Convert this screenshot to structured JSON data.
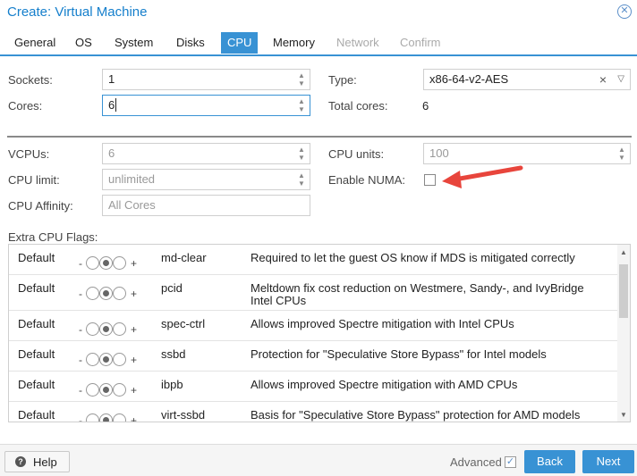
{
  "window": {
    "title": "Create: Virtual Machine"
  },
  "tabs": [
    {
      "label": "General"
    },
    {
      "label": "OS"
    },
    {
      "label": "System"
    },
    {
      "label": "Disks"
    },
    {
      "label": "CPU"
    },
    {
      "label": "Memory"
    },
    {
      "label": "Network"
    },
    {
      "label": "Confirm"
    }
  ],
  "active_tab": "CPU",
  "form": {
    "sockets_label": "Sockets:",
    "sockets_value": "1",
    "cores_label": "Cores:",
    "cores_value": "6",
    "type_label": "Type:",
    "type_value": "x86-64-v2-AES",
    "total_cores_label": "Total cores:",
    "total_cores_value": "6",
    "vcpus_label": "VCPUs:",
    "vcpus_value": "6",
    "cpu_units_label": "CPU units:",
    "cpu_units_value": "100",
    "cpu_limit_label": "CPU limit:",
    "cpu_limit_value": "unlimited",
    "enable_numa_label": "Enable NUMA:",
    "enable_numa_checked": false,
    "cpu_affinity_label": "CPU Affinity:",
    "cpu_affinity_placeholder": "All Cores"
  },
  "flags": {
    "label": "Extra CPU Flags:",
    "minus": "-",
    "plus": "+",
    "rows": [
      {
        "state": "Default",
        "flag": "md-clear",
        "description": "Required to let the guest OS know if MDS is mitigated correctly"
      },
      {
        "state": "Default",
        "flag": "pcid",
        "description": "Meltdown fix cost reduction on Westmere, Sandy-, and IvyBridge Intel CPUs"
      },
      {
        "state": "Default",
        "flag": "spec-ctrl",
        "description": "Allows improved Spectre mitigation with Intel CPUs"
      },
      {
        "state": "Default",
        "flag": "ssbd",
        "description": "Protection for \"Speculative Store Bypass\" for Intel models"
      },
      {
        "state": "Default",
        "flag": "ibpb",
        "description": "Allows improved Spectre mitigation with AMD CPUs"
      },
      {
        "state": "Default",
        "flag": "virt-ssbd",
        "description": "Basis for \"Speculative Store Bypass\" protection for AMD models"
      }
    ]
  },
  "footer": {
    "help_label": "Help",
    "advanced_label": "Advanced",
    "advanced_checked": true,
    "back_label": "Back",
    "next_label": "Next"
  },
  "colors": {
    "accent": "#3892d4",
    "title": "#157fcc",
    "annotation_arrow": "#e8453c"
  }
}
